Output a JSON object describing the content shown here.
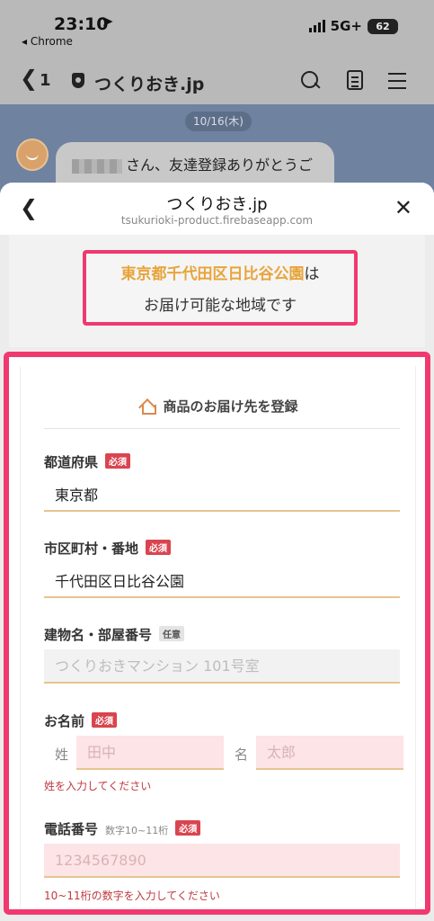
{
  "status_bar": {
    "time": "23:10",
    "location_icon": "location-arrow-icon",
    "back_app": "◂ Chrome",
    "network": "5G+",
    "battery": "62"
  },
  "line_header": {
    "back_count": "1",
    "title": "つくりおき.jp"
  },
  "chat": {
    "date": "10/16(木)",
    "message": "さん、友達登録ありがとうご"
  },
  "sheet": {
    "title": "つくりおき.jp",
    "url": "tsukurioki-product.firebaseapp.com"
  },
  "notice": {
    "address": "東京都千代田区日比谷公園",
    "suffix": "は",
    "line2": "お届け可能な地域です"
  },
  "form": {
    "heading": "商品のお届け先を登録",
    "prefecture": {
      "label": "都道府県",
      "badge": "必須",
      "value": "東京都"
    },
    "city": {
      "label": "市区町村・番地",
      "badge": "必須",
      "value": "千代田区日比谷公園"
    },
    "building": {
      "label": "建物名・部屋番号",
      "badge": "任意",
      "placeholder": "つくりおきマンション 101号室"
    },
    "name": {
      "label": "お名前",
      "badge": "必須",
      "last_prefix": "姓",
      "last_placeholder": "田中",
      "first_prefix": "名",
      "first_placeholder": "太郎",
      "error": "姓を入力してください"
    },
    "phone": {
      "label": "電話番号",
      "hint": "数字10~11桁",
      "badge": "必須",
      "placeholder": "1234567890",
      "error": "10~11桁の数字を入力してください"
    }
  },
  "colors": {
    "highlight_border": "#f0396f",
    "address_accent": "#e8a43a",
    "required_badge": "#d9454f",
    "error_text": "#c0393f"
  }
}
